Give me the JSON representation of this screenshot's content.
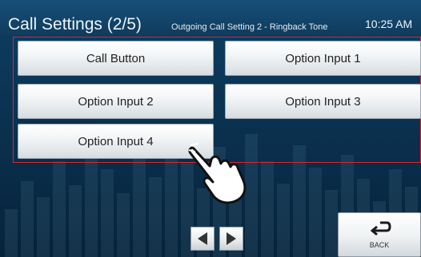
{
  "header": {
    "title": "Call Settings (2/5)",
    "subtitle": "Outgoing Call Setting 2 - Ringback Tone",
    "time": "10:25 AM"
  },
  "options": [
    {
      "label": "Call Button"
    },
    {
      "label": "Option Input 1"
    },
    {
      "label": "Option Input 2"
    },
    {
      "label": "Option Input 3"
    },
    {
      "label": "Option Input 4"
    }
  ],
  "navigation": {
    "prev_icon": "triangle-left-icon",
    "next_icon": "triangle-right-icon",
    "back_label": "BACK",
    "back_icon": "return-arrow-icon"
  },
  "colors": {
    "highlight": "#d9262d",
    "background": "#0d3f63"
  }
}
